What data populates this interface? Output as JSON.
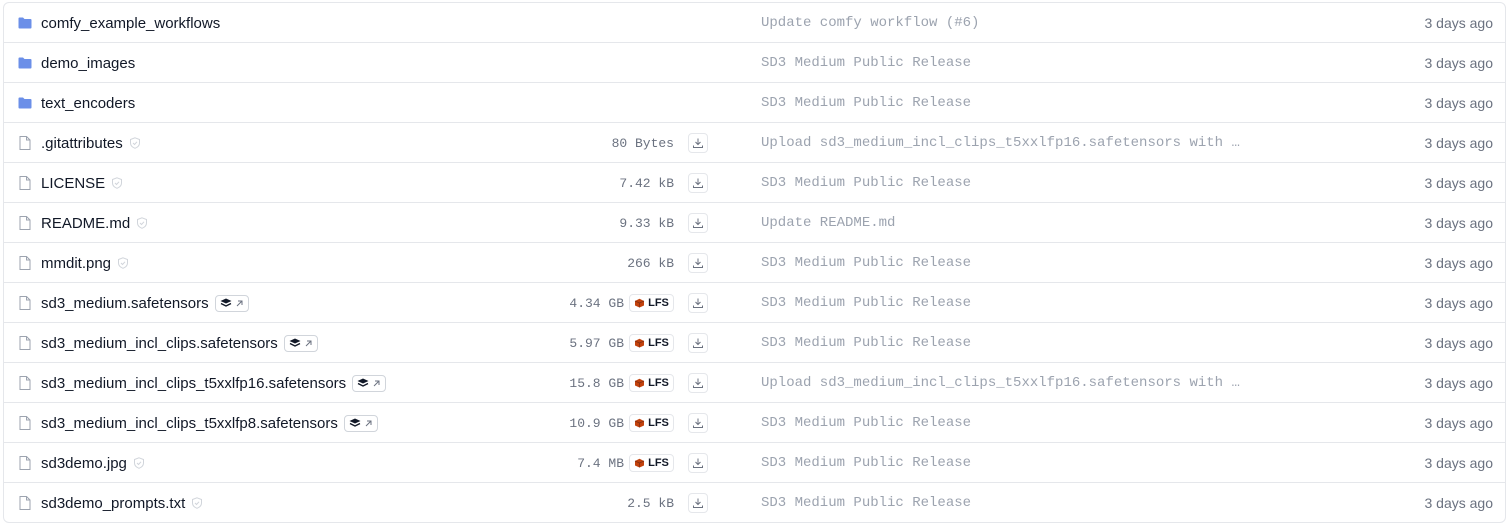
{
  "colors": {
    "folder": "#6b8fe8",
    "file_icon": "#9ca3af",
    "lfs_brick": "#c2410c",
    "commit_text": "#9ca3af",
    "border": "#e5e7eb"
  },
  "icons": {
    "folder": "folder-icon",
    "file": "file-icon",
    "safe": "shield-check-icon",
    "scan": "layers-arrow-icon",
    "lfs": "brick-icon",
    "download": "download-icon"
  },
  "rows": [
    {
      "type": "folder",
      "name": "comfy_example_workflows",
      "size": "",
      "lfs": false,
      "badge": "none",
      "commit": "Update comfy workflow (#6)",
      "date": "3 days ago"
    },
    {
      "type": "folder",
      "name": "demo_images",
      "size": "",
      "lfs": false,
      "badge": "none",
      "commit": "SD3 Medium Public Release",
      "date": "3 days ago"
    },
    {
      "type": "folder",
      "name": "text_encoders",
      "size": "",
      "lfs": false,
      "badge": "none",
      "commit": "SD3 Medium Public Release",
      "date": "3 days ago"
    },
    {
      "type": "file",
      "name": ".gitattributes",
      "size": "80 Bytes",
      "lfs": false,
      "badge": "safe",
      "commit": "Upload sd3_medium_incl_clips_t5xxlfp16.safetensors with …",
      "date": "3 days ago"
    },
    {
      "type": "file",
      "name": "LICENSE",
      "size": "7.42 kB",
      "lfs": false,
      "badge": "safe",
      "commit": "SD3 Medium Public Release",
      "date": "3 days ago"
    },
    {
      "type": "file",
      "name": "README.md",
      "size": "9.33 kB",
      "lfs": false,
      "badge": "safe",
      "commit": "Update README.md",
      "date": "3 days ago"
    },
    {
      "type": "file",
      "name": "mmdit.png",
      "size": "266 kB",
      "lfs": false,
      "badge": "safe",
      "commit": "SD3 Medium Public Release",
      "date": "3 days ago"
    },
    {
      "type": "file",
      "name": "sd3_medium.safetensors",
      "size": "4.34 GB",
      "lfs": true,
      "badge": "scan",
      "commit": "SD3 Medium Public Release",
      "date": "3 days ago"
    },
    {
      "type": "file",
      "name": "sd3_medium_incl_clips.safetensors",
      "size": "5.97 GB",
      "lfs": true,
      "badge": "scan",
      "commit": "SD3 Medium Public Release",
      "date": "3 days ago"
    },
    {
      "type": "file",
      "name": "sd3_medium_incl_clips_t5xxlfp16.safetensors",
      "size": "15.8 GB",
      "lfs": true,
      "badge": "scan",
      "commit": "Upload sd3_medium_incl_clips_t5xxlfp16.safetensors with …",
      "date": "3 days ago"
    },
    {
      "type": "file",
      "name": "sd3_medium_incl_clips_t5xxlfp8.safetensors",
      "size": "10.9 GB",
      "lfs": true,
      "badge": "scan",
      "commit": "SD3 Medium Public Release",
      "date": "3 days ago"
    },
    {
      "type": "file",
      "name": "sd3demo.jpg",
      "size": "7.4 MB",
      "lfs": true,
      "badge": "safe",
      "commit": "SD3 Medium Public Release",
      "date": "3 days ago"
    },
    {
      "type": "file",
      "name": "sd3demo_prompts.txt",
      "size": "2.5 kB",
      "lfs": false,
      "badge": "safe",
      "commit": "SD3 Medium Public Release",
      "date": "3 days ago"
    }
  ],
  "lfs_label": "LFS"
}
